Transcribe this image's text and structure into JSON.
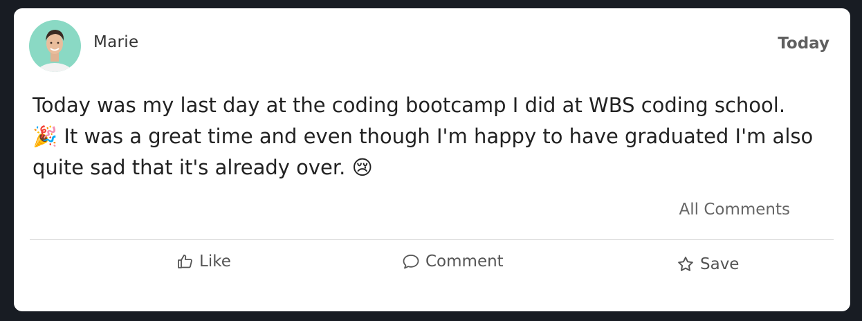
{
  "post": {
    "author": "Marie",
    "date": "Today",
    "text": "Today was my last day at the coding bootcamp I did at WBS coding school.\n🎉 It was a great time and even though I'm happy to have graduated I'm also\nquite sad that it's already over. 😢",
    "all_comments_label": "All Comments"
  },
  "actions": {
    "like_label": "Like",
    "comment_label": "Comment",
    "save_label": "Save"
  },
  "icons": {
    "like": "thumbs-up-icon",
    "comment": "speech-bubble-icon",
    "save": "star-icon"
  },
  "colors": {
    "page_bg": "#181c23",
    "card_bg": "#ffffff",
    "avatar_bg": "#8ad9c4"
  }
}
